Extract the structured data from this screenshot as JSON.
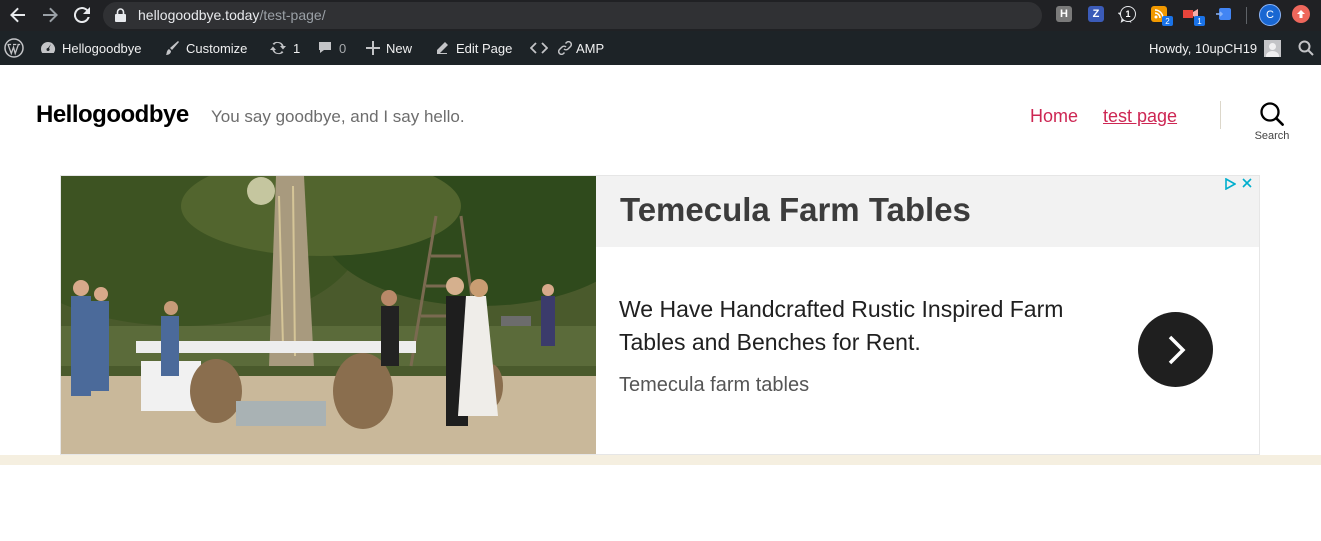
{
  "browser": {
    "url_host": "hellogoodbye.today",
    "url_path": "/test-page/",
    "extensions": [
      {
        "name": "h-icon",
        "letter": "H",
        "color": "#7a7a7a"
      },
      {
        "name": "z-icon",
        "letter": "Z",
        "color": "#3b5bb8"
      },
      {
        "name": "onepassword-icon",
        "letter": "1",
        "color": "#202124"
      },
      {
        "name": "rss-icon",
        "letter": "",
        "color": "#f29900",
        "badge": "2"
      },
      {
        "name": "extension-red-icon",
        "letter": "",
        "color": "#e8453c",
        "badge": "1"
      },
      {
        "name": "extension-blue-icon",
        "letter": "",
        "color": "#4285f4"
      }
    ],
    "profile_initial": "C"
  },
  "adminbar": {
    "site_name": "Hellogoodbye",
    "customize": "Customize",
    "updates_count": "1",
    "comments_count": "0",
    "new_label": "New",
    "edit_label": "Edit Page",
    "amp_label": "AMP",
    "howdy": "Howdy, 10upCH19"
  },
  "site": {
    "title": "Hellogoodbye",
    "description": "You say goodbye, and I say hello.",
    "menu": [
      "Home",
      "test page"
    ],
    "search_label": "Search"
  },
  "ad": {
    "title": "Temecula Farm Tables",
    "body": "We Have Handcrafted Rustic Inspired Farm Tables and Benches for Rent.",
    "display_url": "Temecula farm tables"
  }
}
